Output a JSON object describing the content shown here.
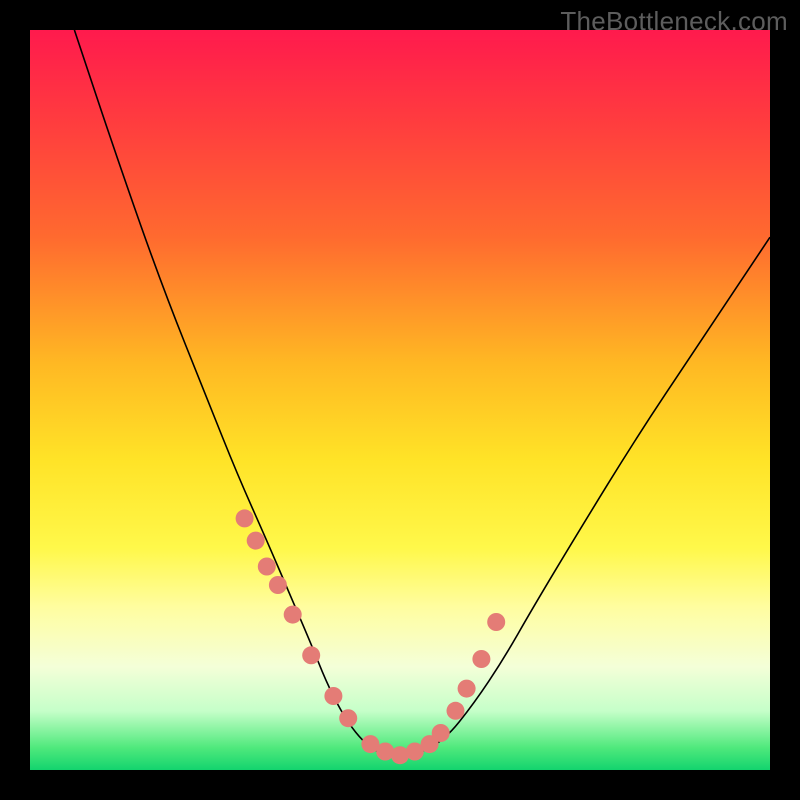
{
  "attribution": "TheBottleneck.com",
  "chart_data": {
    "type": "line",
    "title": "",
    "xlabel": "",
    "ylabel": "",
    "xlim": [
      0,
      100
    ],
    "ylim": [
      0,
      100
    ],
    "series": [
      {
        "name": "bottleneck-curve",
        "x": [
          6,
          12,
          18,
          24,
          28,
          32,
          35,
          38,
          40,
          42,
          44,
          46,
          48,
          50,
          52,
          56,
          60,
          64,
          68,
          74,
          82,
          90,
          100
        ],
        "y": [
          100,
          82,
          65,
          50,
          40,
          31,
          24,
          17,
          12,
          8,
          5,
          3,
          2,
          2,
          2,
          4,
          9,
          15,
          22,
          32,
          45,
          57,
          72
        ]
      }
    ],
    "highlighted_points": {
      "name": "marked-points",
      "x": [
        29,
        30.5,
        32,
        33.5,
        35.5,
        38,
        41,
        43,
        46,
        48,
        50,
        52,
        54,
        55.5,
        57.5,
        59,
        61,
        63
      ],
      "y": [
        34,
        31,
        27.5,
        25,
        21,
        15.5,
        10,
        7,
        3.5,
        2.5,
        2,
        2.5,
        3.5,
        5,
        8,
        11,
        15,
        20
      ]
    },
    "gradient_scale": {
      "top_color": "#ff1a4d",
      "bottom_color": "#13d46e",
      "meaning_top": "high-bottleneck",
      "meaning_bottom": "low-bottleneck"
    }
  }
}
